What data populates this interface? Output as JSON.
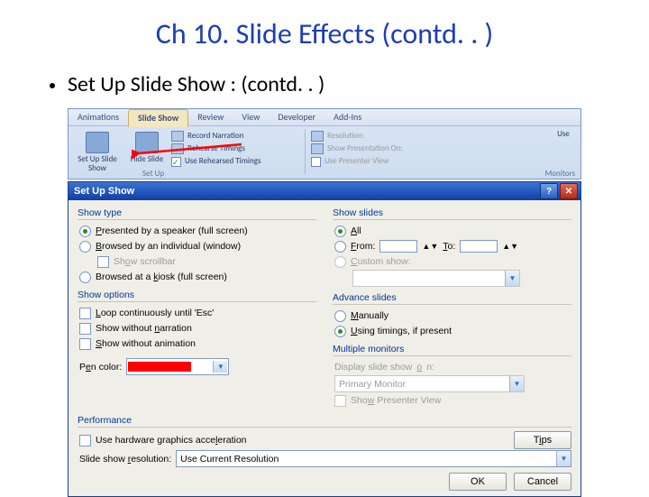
{
  "title": "Ch 10. Slide Effects (contd. . )",
  "bullet": "Set Up Slide Show : (contd. . )",
  "ribbon": {
    "tabs": [
      "Animations",
      "Slide Show",
      "Review",
      "View",
      "Developer",
      "Add-Ins"
    ],
    "right_group_hint": "Use",
    "big_setup": "Set Up Slide Show",
    "big_hide": "Hide Slide",
    "record_narration": "Record Narration",
    "rehearse_timings": "Rehearse Timings",
    "use_rehearsed": "Use Rehearsed Timings",
    "group": "Set Up",
    "resolution": "Resolution:",
    "present_on": "Show Presentation On:",
    "presenter_view": "Use Presenter View",
    "monitors": "Monitors"
  },
  "dialog": {
    "title": "Set Up Show",
    "show_type": {
      "title": "Show type",
      "speaker": "Presented by a speaker (full screen)",
      "individual": "Browsed by an individual (window)",
      "scrollbar": "Show scrollbar",
      "kiosk": "Browsed at a kiosk (full screen)"
    },
    "show_options": {
      "title": "Show options",
      "loop": "Loop continuously until 'Esc'",
      "without_narration": "Show without narration",
      "without_animation": "Show without animation",
      "pen_color": "Pen color:"
    },
    "show_slides": {
      "title": "Show slides",
      "all": "All",
      "from": "From:",
      "to": "To:",
      "custom": "Custom show:"
    },
    "advance": {
      "title": "Advance slides",
      "manual": "Manually",
      "timings": "Using timings, if present"
    },
    "monitors": {
      "title": "Multiple monitors",
      "display_on": "Display slide show on:",
      "value": "Primary Monitor",
      "presenter_view": "Show Presenter View"
    },
    "performance": {
      "title": "Performance",
      "hw_accel": "Use hardware graphics acceleration",
      "tips": "Tips",
      "res_label": "Slide show resolution:",
      "res_value": "Use Current Resolution"
    },
    "ok": "OK",
    "cancel": "Cancel"
  }
}
